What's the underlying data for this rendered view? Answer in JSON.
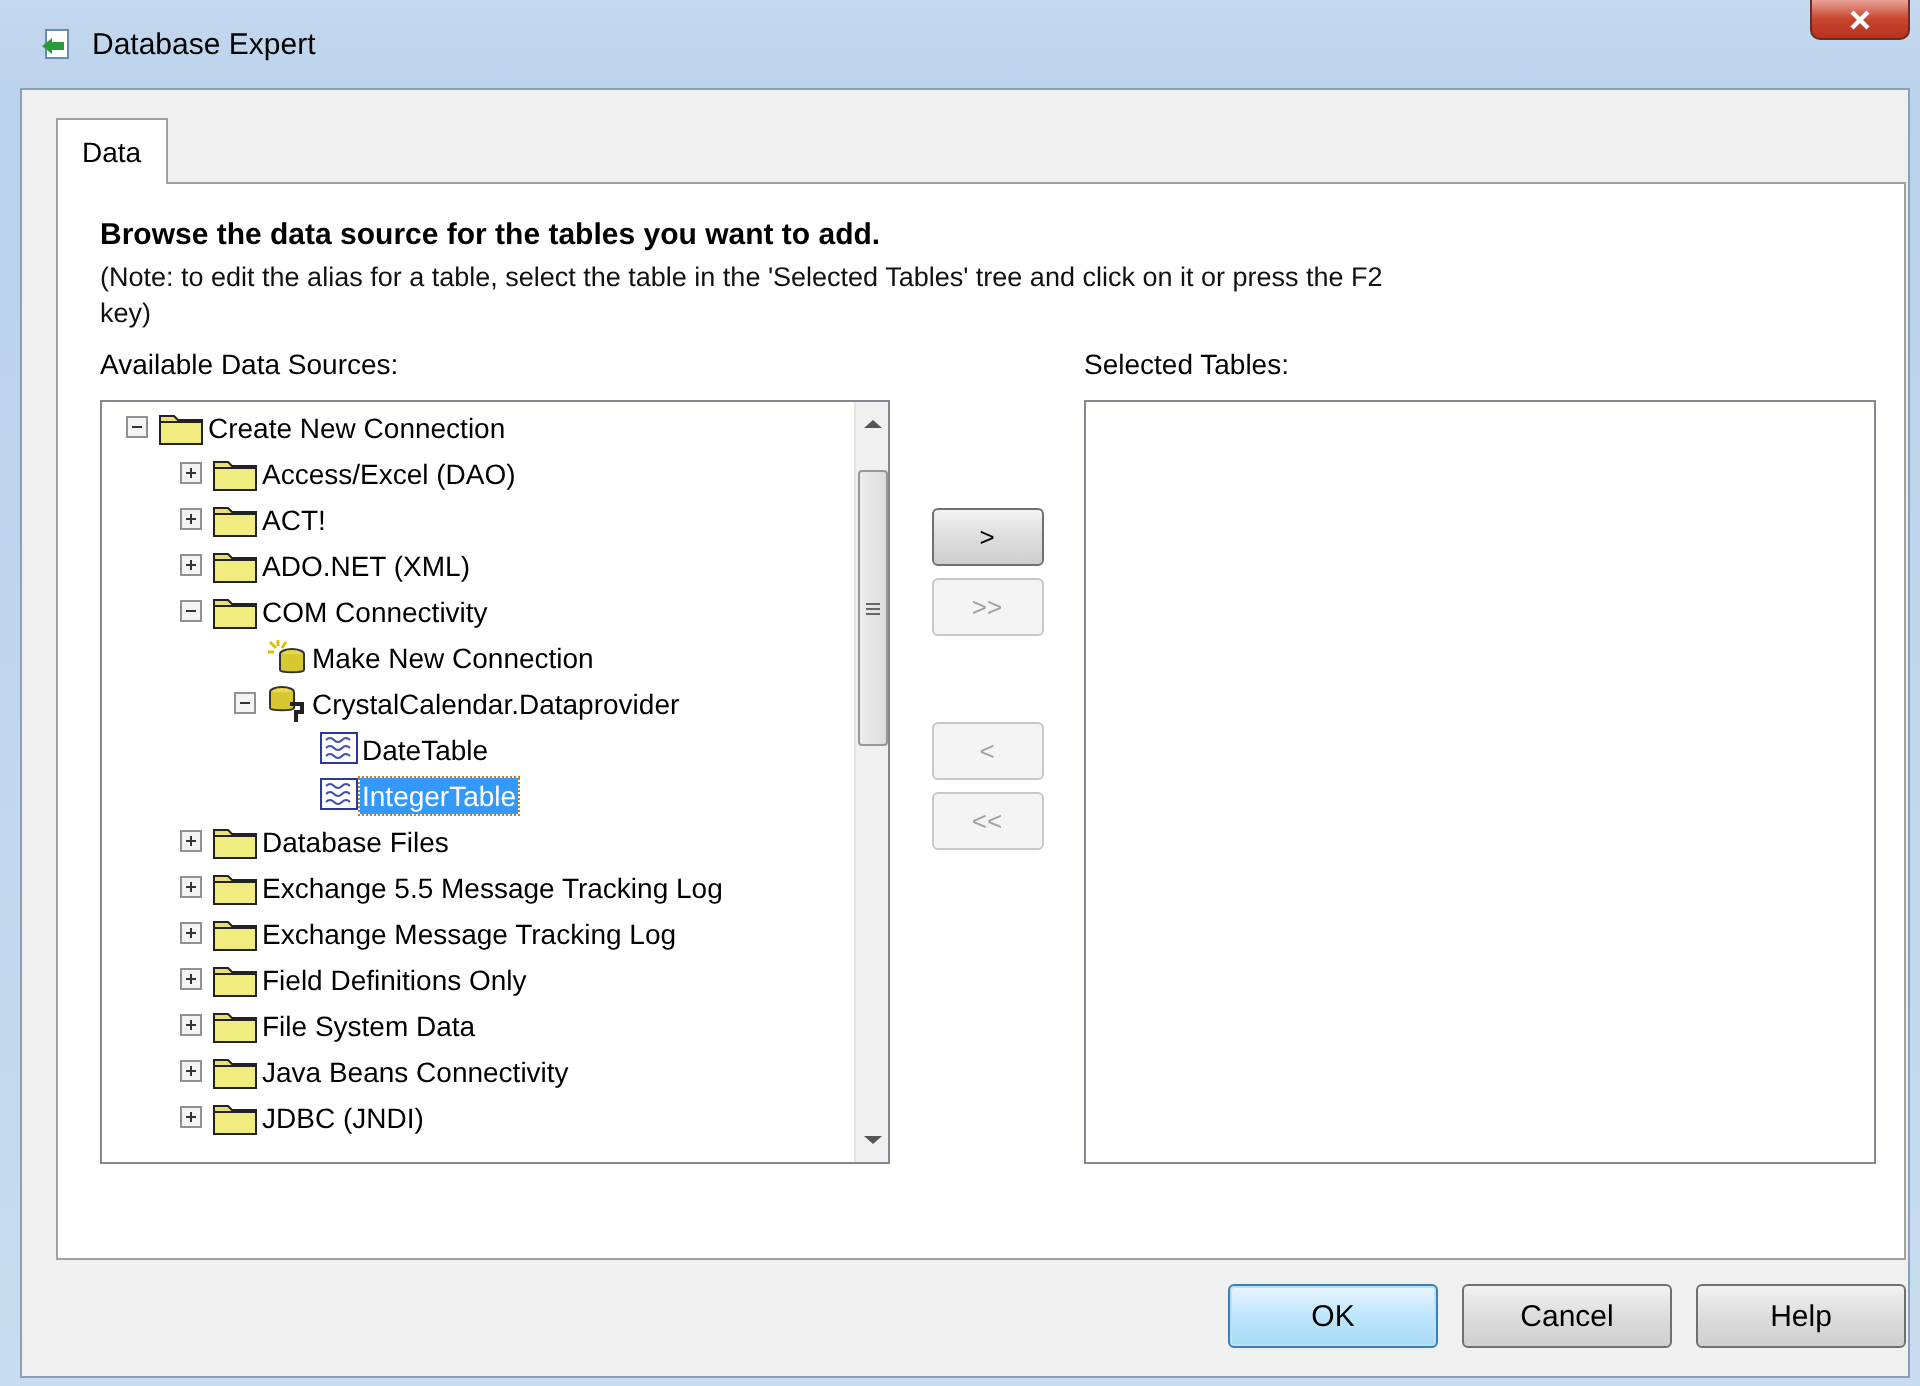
{
  "window": {
    "title": "Database Expert"
  },
  "tabs": [
    {
      "label": "Data",
      "selected": true
    }
  ],
  "heading": "Browse the data source for the tables you want to add.",
  "note": "(Note: to edit the alias for a table, select the table in the 'Selected Tables' tree and click on it or press the F2 key)",
  "available_label": "Available Data Sources:",
  "selected_label": "Selected Tables:",
  "tree": [
    {
      "label": "Create New Connection",
      "kind": "folder",
      "expanded": true,
      "selected": false,
      "children": [
        {
          "label": "Access/Excel (DAO)",
          "kind": "folder",
          "expanded": false,
          "selected": false
        },
        {
          "label": "ACT!",
          "kind": "folder",
          "expanded": false,
          "selected": false
        },
        {
          "label": "ADO.NET (XML)",
          "kind": "folder",
          "expanded": false,
          "selected": false
        },
        {
          "label": "COM Connectivity",
          "kind": "folder",
          "expanded": true,
          "selected": false,
          "children": [
            {
              "label": "Make New Connection",
              "kind": "new-connection",
              "selected": false
            },
            {
              "label": "CrystalCalendar.Dataprovider",
              "kind": "connection",
              "expanded": true,
              "selected": false,
              "children": [
                {
                  "label": "DateTable",
                  "kind": "table",
                  "selected": false
                },
                {
                  "label": "IntegerTable",
                  "kind": "table",
                  "selected": true
                }
              ]
            }
          ]
        },
        {
          "label": "Database Files",
          "kind": "folder",
          "expanded": false,
          "selected": false
        },
        {
          "label": "Exchange 5.5 Message Tracking Log",
          "kind": "folder",
          "expanded": false,
          "selected": false
        },
        {
          "label": "Exchange Message Tracking Log",
          "kind": "folder",
          "expanded": false,
          "selected": false
        },
        {
          "label": "Field Definitions Only",
          "kind": "folder",
          "expanded": false,
          "selected": false
        },
        {
          "label": "File System Data",
          "kind": "folder",
          "expanded": false,
          "selected": false
        },
        {
          "label": "Java Beans Connectivity",
          "kind": "folder",
          "expanded": false,
          "selected": false
        },
        {
          "label": "JDBC (JNDI)",
          "kind": "folder",
          "expanded": false,
          "selected": false
        }
      ]
    }
  ],
  "transfer_buttons": [
    {
      "label": ">",
      "disabled": false
    },
    {
      "label": ">>",
      "disabled": true
    },
    {
      "label": "<",
      "disabled": true
    },
    {
      "label": "<<",
      "disabled": true
    }
  ],
  "footer_buttons": [
    {
      "label": "OK",
      "default": true
    },
    {
      "label": "Cancel",
      "default": false
    },
    {
      "label": "Help",
      "default": false
    }
  ]
}
